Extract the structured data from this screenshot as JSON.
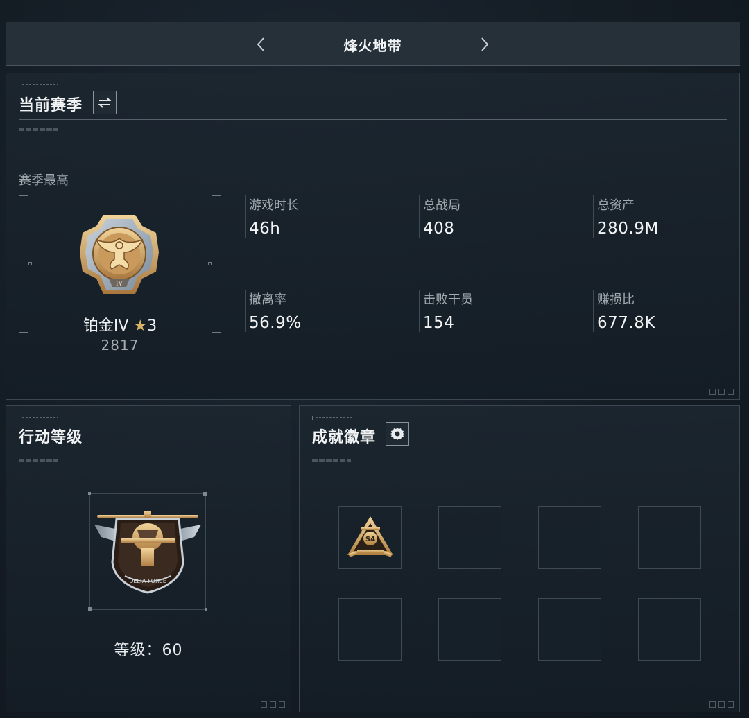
{
  "header": {
    "title": "烽火地带",
    "prev_icon": "chevron-left-icon",
    "next_icon": "chevron-right-icon"
  },
  "season": {
    "title": "当前赛季",
    "switch_icon": "swap-icon",
    "best_label": "赛季最高",
    "rank": {
      "name": "铂金IV",
      "star_glyph": "★",
      "stars": "3",
      "points": "2817",
      "emblem_icon": "eagle-rank-emblem-icon"
    },
    "stats": [
      {
        "label": "游戏时长",
        "value": "46h"
      },
      {
        "label": "总战局",
        "value": "408"
      },
      {
        "label": "总资产",
        "value": "280.9M"
      },
      {
        "label": "撤离率",
        "value": "56.9%"
      },
      {
        "label": "击败干员",
        "value": "154"
      },
      {
        "label": "赚损比",
        "value": "677.8K"
      }
    ]
  },
  "operation_level": {
    "title": "行动等级",
    "emblem_icon": "helicopter-emblem-icon",
    "emblem_text": "DELTA FORCE",
    "level_label": "等级：",
    "level_value": "60"
  },
  "badges": {
    "title": "成就徽章",
    "settings_icon": "gear-icon",
    "slots": [
      {
        "filled": true,
        "label": "S4",
        "icon": "s4-badge-icon"
      },
      {
        "filled": false
      },
      {
        "filled": false
      },
      {
        "filled": false
      },
      {
        "filled": false
      },
      {
        "filled": false
      },
      {
        "filled": false
      },
      {
        "filled": false
      }
    ]
  },
  "colors": {
    "gold": "#d8b366",
    "panel_bg": "#1c262f",
    "border": "#3a4651",
    "text": "#f2f4f5"
  }
}
